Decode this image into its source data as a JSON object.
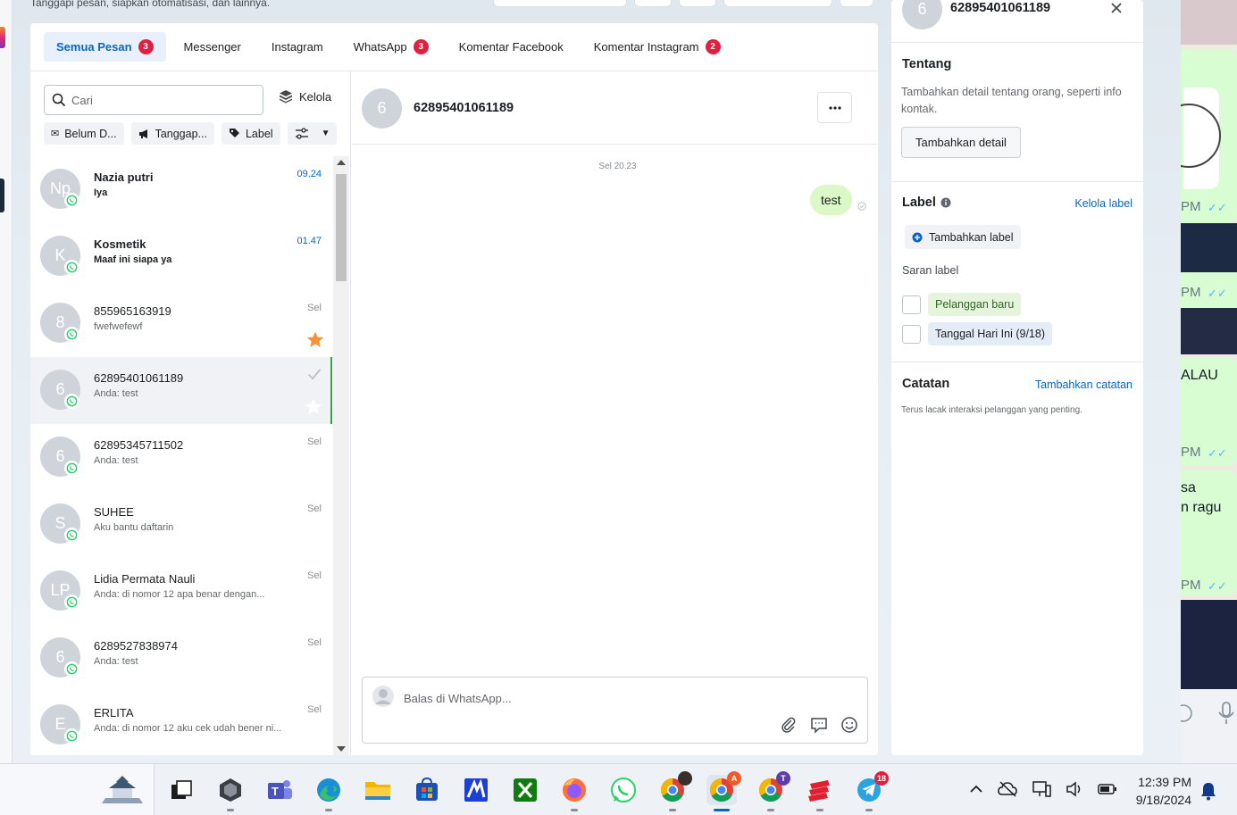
{
  "header": {
    "description": "Tanggapi pesan, siapkan otomatisasi, dan lainnya."
  },
  "tabs": [
    {
      "label": "Semua Pesan",
      "badge": "3",
      "active": true
    },
    {
      "label": "Messenger",
      "badge": ""
    },
    {
      "label": "Instagram",
      "badge": ""
    },
    {
      "label": "WhatsApp",
      "badge": "3"
    },
    {
      "label": "Komentar Facebook",
      "badge": ""
    },
    {
      "label": "Komentar Instagram",
      "badge": "2"
    }
  ],
  "list": {
    "search_placeholder": "Cari",
    "manage_label": "Kelola",
    "filters": [
      "Belum D...",
      "Tanggap...",
      "Label"
    ]
  },
  "conversations": [
    {
      "initials": "Np",
      "name": "Nazia putri",
      "preview": "Iya",
      "time": "09.24",
      "unread": true
    },
    {
      "initials": "K",
      "name": "Kosmetik",
      "preview": "Maaf ini siapa ya",
      "time": "01.47",
      "unread": true
    },
    {
      "initials": "8",
      "name": "855965163919",
      "preview": "fwefwefewf",
      "time": "Sel",
      "starred": true
    },
    {
      "initials": "6",
      "name": "62895401061189",
      "preview": "Anda: test",
      "time": "",
      "selected": true
    },
    {
      "initials": "6",
      "name": "62895345711502",
      "preview": "Anda: test",
      "time": "Sel"
    },
    {
      "initials": "S",
      "name": "SUHEE",
      "preview": "Aku bantu daftarin",
      "time": "Sel"
    },
    {
      "initials": "LP",
      "name": "Lidia Permata Nauli",
      "preview": "Anda: di nomor 12 apa benar dengan...",
      "time": "Sel"
    },
    {
      "initials": "6",
      "name": "6289527838974",
      "preview": "Anda: test",
      "time": "Sel"
    },
    {
      "initials": "E",
      "name": "ERLITA",
      "preview": "Anda: di nomor 12 aku cek udah bener ni...",
      "time": "Sel"
    }
  ],
  "chat": {
    "avatar_initial": "6",
    "title": "62895401061189",
    "date_separator": "Sel 20.23",
    "messages": [
      {
        "text": "test",
        "from": "me"
      }
    ],
    "composer_placeholder": "Balas di WhatsApp..."
  },
  "details": {
    "avatar_initial": "6",
    "number": "62895401061189",
    "about_title": "Tentang",
    "about_text": "Tambahkan detail tentang orang, seperti info kontak.",
    "add_detail_button": "Tambahkan detail",
    "label_title": "Label",
    "manage_labels_link": "Kelola label",
    "add_label_button": "Tambahkan label",
    "suggested_title": "Saran label",
    "suggested_labels": [
      "Pelanggan baru",
      "Tanggal Hari Ini (9/18)"
    ],
    "notes_title": "Catatan",
    "add_note_link": "Tambahkan catatan",
    "notes_text": "Terus lacak interaksi pelanggan yang penting."
  },
  "phone_window": {
    "times": [
      "PM",
      "PM",
      "PM",
      "PM"
    ],
    "texts": [
      "ALAU",
      "sa",
      "n ragu"
    ]
  },
  "taskbar": {
    "apps": [
      {
        "icon": "task-view-icon"
      },
      {
        "icon": "app-icon"
      },
      {
        "icon": "teams-icon"
      },
      {
        "icon": "edge-icon"
      },
      {
        "icon": "file-explorer-icon"
      },
      {
        "icon": "store-icon"
      },
      {
        "icon": "app-m-icon"
      },
      {
        "icon": "xbox-icon"
      },
      {
        "icon": "firefox-icon"
      },
      {
        "icon": "whatsapp-icon"
      },
      {
        "icon": "chrome-icon"
      },
      {
        "icon": "chrome-profile-a-icon",
        "badge": "A"
      },
      {
        "icon": "chrome-profile-t-icon",
        "badge": "T"
      },
      {
        "icon": "stack-icon"
      },
      {
        "icon": "telegram-icon",
        "badge": "18"
      }
    ],
    "time": "12:39 PM",
    "date": "9/18/2024"
  }
}
